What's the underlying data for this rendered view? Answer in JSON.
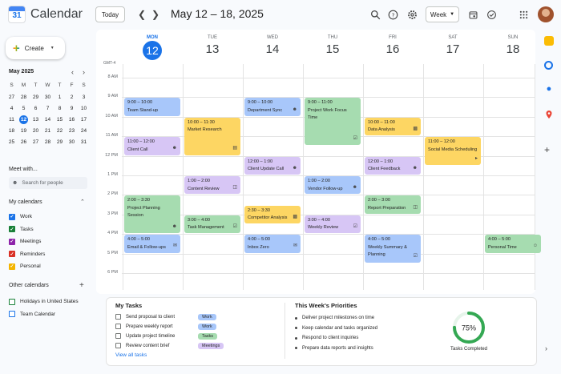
{
  "app": {
    "title": "Calendar",
    "logo_day": "31"
  },
  "header": {
    "today_label": "Today",
    "date_range": "May 12 – 18, 2025",
    "view_label": "Week"
  },
  "sidebar": {
    "create_label": "Create",
    "mini_month": "May 2025",
    "weekday_initials": [
      "S",
      "M",
      "T",
      "W",
      "T",
      "F",
      "S"
    ],
    "weeks": [
      [
        "27",
        "28",
        "29",
        "30",
        "1",
        "2",
        "3"
      ],
      [
        "4",
        "5",
        "6",
        "7",
        "8",
        "9",
        "10"
      ],
      [
        "11",
        "12",
        "13",
        "14",
        "15",
        "16",
        "17"
      ],
      [
        "18",
        "19",
        "20",
        "21",
        "22",
        "23",
        "24"
      ],
      [
        "25",
        "26",
        "27",
        "28",
        "29",
        "30",
        "31"
      ]
    ],
    "selected_day": "12",
    "meet_with": "Meet with...",
    "search_people": "Search for people",
    "my_calendars_title": "My calendars",
    "my_calendars": [
      {
        "label": "Work",
        "color": "#1a73e8"
      },
      {
        "label": "Tasks",
        "color": "#188038"
      },
      {
        "label": "Meetings",
        "color": "#8e24aa"
      },
      {
        "label": "Reminders",
        "color": "#d93025"
      },
      {
        "label": "Personal",
        "color": "#f4b400"
      }
    ],
    "other_calendars_title": "Other calendars",
    "other_calendars": [
      {
        "label": "Holidays in United States",
        "color": "#188038"
      },
      {
        "label": "Team Calendar",
        "color": "#1a73e8"
      }
    ]
  },
  "grid": {
    "timezone": "GMT-4",
    "days": [
      {
        "name": "MON",
        "num": "12",
        "today": true
      },
      {
        "name": "TUE",
        "num": "13"
      },
      {
        "name": "WED",
        "num": "14"
      },
      {
        "name": "THU",
        "num": "15"
      },
      {
        "name": "FRI",
        "num": "16"
      },
      {
        "name": "SAT",
        "num": "17"
      },
      {
        "name": "SUN",
        "num": "18"
      }
    ],
    "hours": [
      "8 AM",
      "9 AM",
      "10 AM",
      "11 AM",
      "12 PM",
      "1 PM",
      "2 PM",
      "3 PM",
      "4 PM",
      "5 PM",
      "6 PM"
    ]
  },
  "events": [
    {
      "day": 0,
      "start": 9.0,
      "end": 10.0,
      "time": "9:00 – 10:00",
      "title": "Team Stand-up",
      "color": "blue",
      "icon": "none"
    },
    {
      "day": 0,
      "start": 11.0,
      "end": 12.0,
      "time": "11:00 – 12:00",
      "title": "Client Call",
      "color": "purple",
      "icon": "people-icon"
    },
    {
      "day": 0,
      "start": 14.0,
      "end": 16.0,
      "time": "2:00 – 3:30",
      "title": "Project Planning Session",
      "color": "green",
      "icon": "people-icon"
    },
    {
      "day": 0,
      "start": 16.0,
      "end": 17.0,
      "time": "4:00 – 5:00",
      "title": "Email & Follow-ups",
      "color": "blue",
      "icon": "mail-icon"
    },
    {
      "day": 1,
      "start": 10.0,
      "end": 12.0,
      "time": "10:00 – 11:30",
      "title": "Market Research",
      "color": "yellow",
      "icon": "note-icon"
    },
    {
      "day": 1,
      "start": 13.0,
      "end": 14.0,
      "time": "1:00 – 2:00",
      "title": "Content Review",
      "color": "purple",
      "icon": "clipboard-icon"
    },
    {
      "day": 1,
      "start": 15.0,
      "end": 16.0,
      "time": "3:00 – 4:00",
      "title": "Task Management",
      "color": "green",
      "icon": "check-icon"
    },
    {
      "day": 2,
      "start": 9.0,
      "end": 10.0,
      "time": "9:00 – 10:00",
      "title": "Department Sync",
      "color": "blue",
      "icon": "people-icon"
    },
    {
      "day": 2,
      "start": 12.0,
      "end": 13.0,
      "time": "12:00 – 1:00",
      "title": "Client Update Call",
      "color": "purple",
      "icon": "people-icon"
    },
    {
      "day": 2,
      "start": 14.5,
      "end": 15.5,
      "time": "2:30 – 3:30",
      "title": "Competitor Analysis",
      "color": "yellow",
      "icon": "chart-icon"
    },
    {
      "day": 2,
      "start": 16.0,
      "end": 17.0,
      "time": "4:00 – 5:00",
      "title": "Inbox Zero",
      "color": "blue",
      "icon": "mail-icon"
    },
    {
      "day": 3,
      "start": 9.0,
      "end": 11.5,
      "time": "9:00 – 11:00",
      "title": "Project Work Focus Time",
      "color": "green",
      "icon": "check-icon"
    },
    {
      "day": 3,
      "start": 13.0,
      "end": 14.0,
      "time": "1:00 – 2:00",
      "title": "Vendor Follow-up",
      "color": "blue",
      "icon": "people-icon"
    },
    {
      "day": 3,
      "start": 15.0,
      "end": 16.0,
      "time": "3:00 – 4:00",
      "title": "Weekly Review",
      "color": "purple",
      "icon": "check-icon"
    },
    {
      "day": 4,
      "start": 10.0,
      "end": 11.0,
      "time": "10:00 – 11:00",
      "title": "Data Analysis",
      "color": "yellow",
      "icon": "chart-icon"
    },
    {
      "day": 4,
      "start": 12.0,
      "end": 13.0,
      "time": "12:00 – 1:00",
      "title": "Client Feedback",
      "color": "purple",
      "icon": "people-icon"
    },
    {
      "day": 4,
      "start": 14.0,
      "end": 15.0,
      "time": "2:00 – 3:00",
      "title": "Report Preparation",
      "color": "green",
      "icon": "clipboard-icon"
    },
    {
      "day": 4,
      "start": 16.0,
      "end": 17.5,
      "time": "4:00 – 5:00",
      "title": "Weekly Summary & Planning",
      "color": "blue",
      "icon": "check-icon"
    },
    {
      "day": 5,
      "start": 11.0,
      "end": 12.5,
      "time": "11:00 – 12:00",
      "title": "Social Media Scheduling",
      "color": "yellow",
      "icon": "megaphone-icon"
    },
    {
      "day": 6,
      "start": 16.0,
      "end": 17.0,
      "time": "4:00 – 5:00",
      "title": "Personal Time",
      "color": "green",
      "icon": "person-icon"
    }
  ],
  "tasks_panel": {
    "title": "My Tasks",
    "items": [
      {
        "label": "Send proposal to client",
        "tag": "Work",
        "tag_color": "#a8c7fa"
      },
      {
        "label": "Prepare weekly report",
        "tag": "Work",
        "tag_color": "#a8c7fa"
      },
      {
        "label": "Update project timeline",
        "tag": "Tasks",
        "tag_color": "#a6dcb0"
      },
      {
        "label": "Review content brief",
        "tag": "Meetings",
        "tag_color": "#d7c6f5"
      }
    ],
    "view_all": "View all tasks"
  },
  "priorities": {
    "title": "This Week's Priorities",
    "items": [
      "Deliver project milestones on time",
      "Keep calendar and tasks organized",
      "Respond to client inquiries",
      "Prepare data reports and insights"
    ]
  },
  "progress": {
    "value": 0.75,
    "label": "75%",
    "caption": "Tasks Completed",
    "color": "#34a853"
  },
  "colors": {
    "accent": "#1a73e8"
  }
}
